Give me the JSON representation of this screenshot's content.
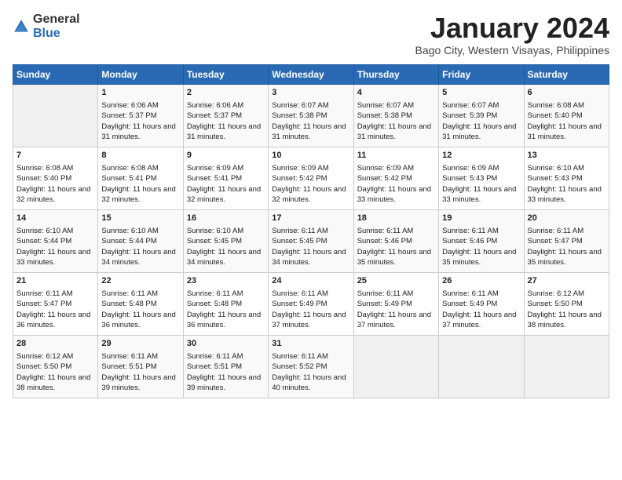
{
  "header": {
    "logo_general": "General",
    "logo_blue": "Blue",
    "month_title": "January 2024",
    "subtitle": "Bago City, Western Visayas, Philippines"
  },
  "days_of_week": [
    "Sunday",
    "Monday",
    "Tuesday",
    "Wednesday",
    "Thursday",
    "Friday",
    "Saturday"
  ],
  "weeks": [
    [
      {
        "day": "",
        "sunrise": "",
        "sunset": "",
        "daylight": ""
      },
      {
        "day": "1",
        "sunrise": "Sunrise: 6:06 AM",
        "sunset": "Sunset: 5:37 PM",
        "daylight": "Daylight: 11 hours and 31 minutes."
      },
      {
        "day": "2",
        "sunrise": "Sunrise: 6:06 AM",
        "sunset": "Sunset: 5:37 PM",
        "daylight": "Daylight: 11 hours and 31 minutes."
      },
      {
        "day": "3",
        "sunrise": "Sunrise: 6:07 AM",
        "sunset": "Sunset: 5:38 PM",
        "daylight": "Daylight: 11 hours and 31 minutes."
      },
      {
        "day": "4",
        "sunrise": "Sunrise: 6:07 AM",
        "sunset": "Sunset: 5:38 PM",
        "daylight": "Daylight: 11 hours and 31 minutes."
      },
      {
        "day": "5",
        "sunrise": "Sunrise: 6:07 AM",
        "sunset": "Sunset: 5:39 PM",
        "daylight": "Daylight: 11 hours and 31 minutes."
      },
      {
        "day": "6",
        "sunrise": "Sunrise: 6:08 AM",
        "sunset": "Sunset: 5:40 PM",
        "daylight": "Daylight: 11 hours and 31 minutes."
      }
    ],
    [
      {
        "day": "7",
        "sunrise": "Sunrise: 6:08 AM",
        "sunset": "Sunset: 5:40 PM",
        "daylight": "Daylight: 11 hours and 32 minutes."
      },
      {
        "day": "8",
        "sunrise": "Sunrise: 6:08 AM",
        "sunset": "Sunset: 5:41 PM",
        "daylight": "Daylight: 11 hours and 32 minutes."
      },
      {
        "day": "9",
        "sunrise": "Sunrise: 6:09 AM",
        "sunset": "Sunset: 5:41 PM",
        "daylight": "Daylight: 11 hours and 32 minutes."
      },
      {
        "day": "10",
        "sunrise": "Sunrise: 6:09 AM",
        "sunset": "Sunset: 5:42 PM",
        "daylight": "Daylight: 11 hours and 32 minutes."
      },
      {
        "day": "11",
        "sunrise": "Sunrise: 6:09 AM",
        "sunset": "Sunset: 5:42 PM",
        "daylight": "Daylight: 11 hours and 33 minutes."
      },
      {
        "day": "12",
        "sunrise": "Sunrise: 6:09 AM",
        "sunset": "Sunset: 5:43 PM",
        "daylight": "Daylight: 11 hours and 33 minutes."
      },
      {
        "day": "13",
        "sunrise": "Sunrise: 6:10 AM",
        "sunset": "Sunset: 5:43 PM",
        "daylight": "Daylight: 11 hours and 33 minutes."
      }
    ],
    [
      {
        "day": "14",
        "sunrise": "Sunrise: 6:10 AM",
        "sunset": "Sunset: 5:44 PM",
        "daylight": "Daylight: 11 hours and 33 minutes."
      },
      {
        "day": "15",
        "sunrise": "Sunrise: 6:10 AM",
        "sunset": "Sunset: 5:44 PM",
        "daylight": "Daylight: 11 hours and 34 minutes."
      },
      {
        "day": "16",
        "sunrise": "Sunrise: 6:10 AM",
        "sunset": "Sunset: 5:45 PM",
        "daylight": "Daylight: 11 hours and 34 minutes."
      },
      {
        "day": "17",
        "sunrise": "Sunrise: 6:11 AM",
        "sunset": "Sunset: 5:45 PM",
        "daylight": "Daylight: 11 hours and 34 minutes."
      },
      {
        "day": "18",
        "sunrise": "Sunrise: 6:11 AM",
        "sunset": "Sunset: 5:46 PM",
        "daylight": "Daylight: 11 hours and 35 minutes."
      },
      {
        "day": "19",
        "sunrise": "Sunrise: 6:11 AM",
        "sunset": "Sunset: 5:46 PM",
        "daylight": "Daylight: 11 hours and 35 minutes."
      },
      {
        "day": "20",
        "sunrise": "Sunrise: 6:11 AM",
        "sunset": "Sunset: 5:47 PM",
        "daylight": "Daylight: 11 hours and 35 minutes."
      }
    ],
    [
      {
        "day": "21",
        "sunrise": "Sunrise: 6:11 AM",
        "sunset": "Sunset: 5:47 PM",
        "daylight": "Daylight: 11 hours and 36 minutes."
      },
      {
        "day": "22",
        "sunrise": "Sunrise: 6:11 AM",
        "sunset": "Sunset: 5:48 PM",
        "daylight": "Daylight: 11 hours and 36 minutes."
      },
      {
        "day": "23",
        "sunrise": "Sunrise: 6:11 AM",
        "sunset": "Sunset: 5:48 PM",
        "daylight": "Daylight: 11 hours and 36 minutes."
      },
      {
        "day": "24",
        "sunrise": "Sunrise: 6:11 AM",
        "sunset": "Sunset: 5:49 PM",
        "daylight": "Daylight: 11 hours and 37 minutes."
      },
      {
        "day": "25",
        "sunrise": "Sunrise: 6:11 AM",
        "sunset": "Sunset: 5:49 PM",
        "daylight": "Daylight: 11 hours and 37 minutes."
      },
      {
        "day": "26",
        "sunrise": "Sunrise: 6:11 AM",
        "sunset": "Sunset: 5:49 PM",
        "daylight": "Daylight: 11 hours and 37 minutes."
      },
      {
        "day": "27",
        "sunrise": "Sunrise: 6:12 AM",
        "sunset": "Sunset: 5:50 PM",
        "daylight": "Daylight: 11 hours and 38 minutes."
      }
    ],
    [
      {
        "day": "28",
        "sunrise": "Sunrise: 6:12 AM",
        "sunset": "Sunset: 5:50 PM",
        "daylight": "Daylight: 11 hours and 38 minutes."
      },
      {
        "day": "29",
        "sunrise": "Sunrise: 6:11 AM",
        "sunset": "Sunset: 5:51 PM",
        "daylight": "Daylight: 11 hours and 39 minutes."
      },
      {
        "day": "30",
        "sunrise": "Sunrise: 6:11 AM",
        "sunset": "Sunset: 5:51 PM",
        "daylight": "Daylight: 11 hours and 39 minutes."
      },
      {
        "day": "31",
        "sunrise": "Sunrise: 6:11 AM",
        "sunset": "Sunset: 5:52 PM",
        "daylight": "Daylight: 11 hours and 40 minutes."
      },
      {
        "day": "",
        "sunrise": "",
        "sunset": "",
        "daylight": ""
      },
      {
        "day": "",
        "sunrise": "",
        "sunset": "",
        "daylight": ""
      },
      {
        "day": "",
        "sunrise": "",
        "sunset": "",
        "daylight": ""
      }
    ]
  ]
}
